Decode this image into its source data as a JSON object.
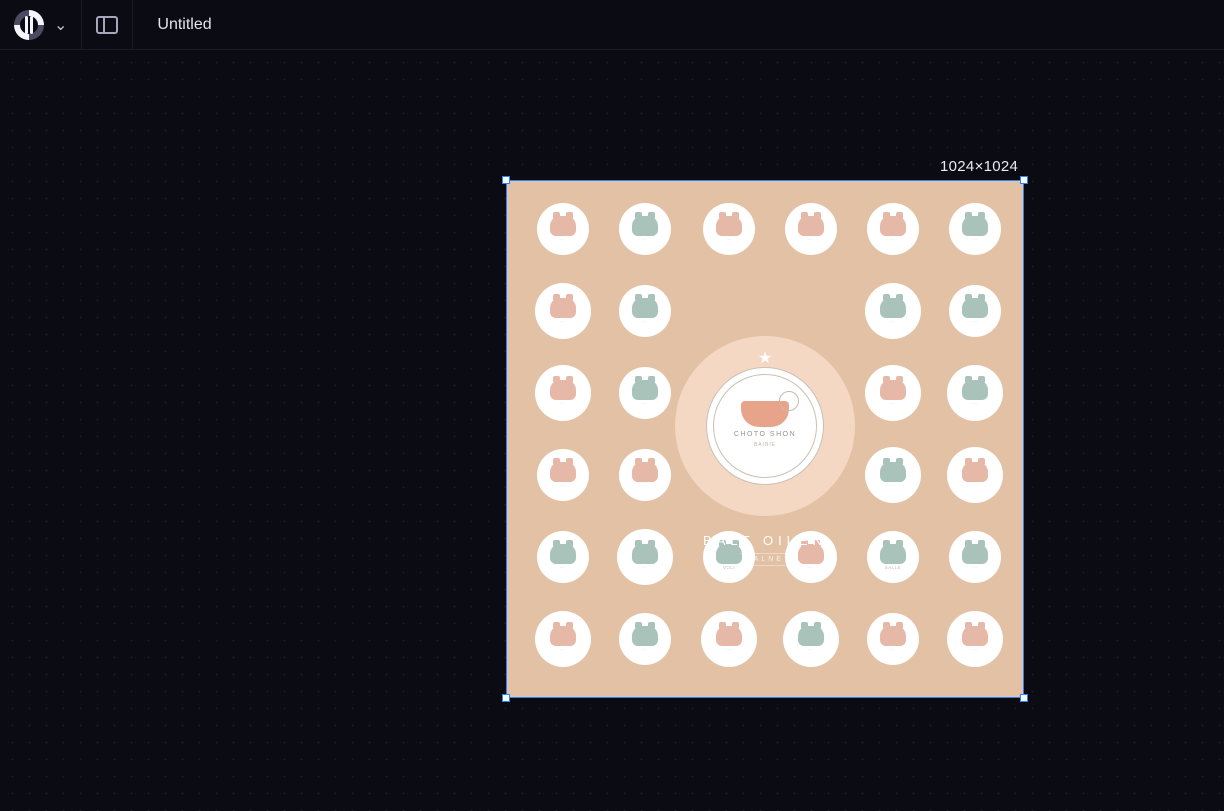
{
  "header": {
    "title": "Untitled"
  },
  "canvas": {
    "dimensions_label": "1024×1024"
  },
  "artwork": {
    "brand_line1": "BALT OILEN",
    "brand_line2": "BALNE",
    "medallion": {
      "line1": "CHOTO SHON",
      "line2": "BAIBIE"
    },
    "badges": [
      {
        "label": "",
        "c": "pink"
      },
      {
        "label": "",
        "c": "teal"
      },
      {
        "label": "",
        "c": "pink"
      },
      {
        "label": "",
        "c": "pink"
      },
      {
        "label": "",
        "c": "pink"
      },
      {
        "label": "",
        "c": "teal"
      },
      {
        "label": "",
        "c": "pink",
        "s": 1
      },
      {
        "label": "",
        "c": "teal"
      },
      {
        "label": "",
        "c": "teal",
        "s": 1
      },
      {
        "label": "",
        "c": "teal"
      },
      {
        "label": "",
        "c": "pink",
        "s": 1
      },
      {
        "label": "",
        "c": "teal"
      },
      {
        "label": "",
        "c": "pink",
        "s": 1
      },
      {
        "label": "",
        "c": "teal",
        "s": 1
      },
      {
        "label": "",
        "c": "pink"
      },
      {
        "label": "",
        "c": "pink"
      },
      {
        "label": "",
        "c": "teal",
        "s": 1
      },
      {
        "label": "",
        "c": "pink",
        "s": 1
      },
      {
        "label": "",
        "c": "teal"
      },
      {
        "label": "",
        "c": "teal",
        "s": 1
      },
      {
        "label": "VOLI",
        "c": "teal"
      },
      {
        "label": "",
        "c": "pink"
      },
      {
        "label": "SALLE",
        "c": "teal"
      },
      {
        "label": "",
        "c": "teal"
      },
      {
        "label": "",
        "c": "pink",
        "s": 1
      },
      {
        "label": "",
        "c": "teal"
      },
      {
        "label": "",
        "c": "pink",
        "s": 1
      },
      {
        "label": "",
        "c": "teal",
        "s": 1
      },
      {
        "label": "",
        "c": "pink"
      },
      {
        "label": "",
        "c": "pink",
        "s": 1
      }
    ]
  }
}
